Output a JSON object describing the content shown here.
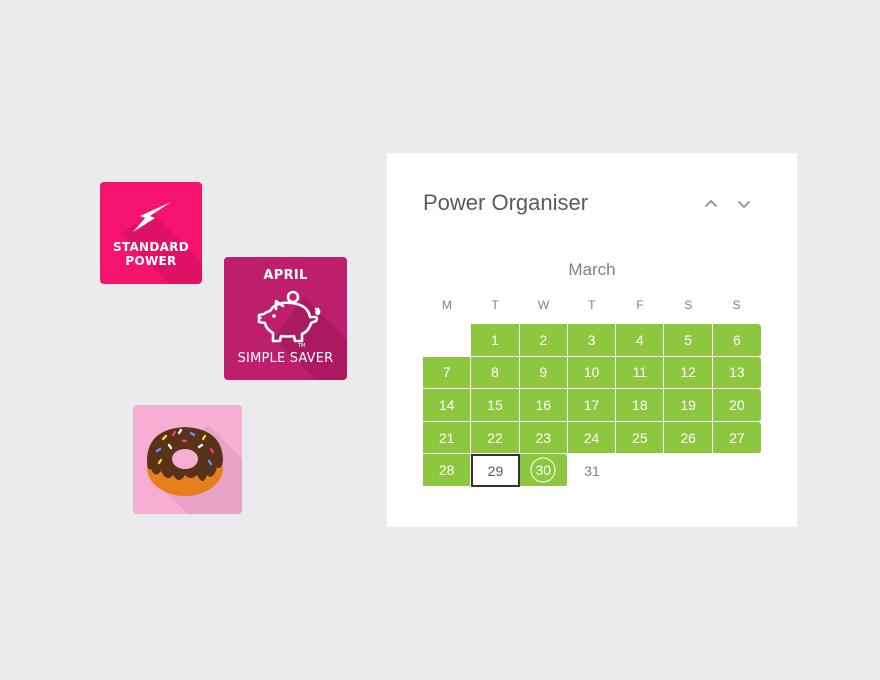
{
  "tiles": {
    "standard_power": {
      "line1": "STANDARD",
      "line2": "POWER",
      "icon": "lightning-bolt-icon",
      "color": "#f4146e"
    },
    "simple_saver": {
      "month": "APRIL",
      "label": "SIMPLE SAVER",
      "icon": "piggy-bank-icon",
      "color": "#be1e6e"
    },
    "donut": {
      "icon": "donut-icon",
      "color": "#f6aed2"
    }
  },
  "calendar": {
    "title": "Power Organiser",
    "month": "March",
    "prev_icon": "chevron-up-icon",
    "next_icon": "chevron-down-icon",
    "accent_color": "#8dc63f",
    "weekdays": [
      "M",
      "T",
      "W",
      "T",
      "F",
      "S",
      "S"
    ],
    "leading_blank_days": 1,
    "days": [
      {
        "label": "1",
        "state": "available"
      },
      {
        "label": "2",
        "state": "available"
      },
      {
        "label": "3",
        "state": "available"
      },
      {
        "label": "4",
        "state": "available"
      },
      {
        "label": "5",
        "state": "available"
      },
      {
        "label": "6",
        "state": "available"
      },
      {
        "label": "7",
        "state": "available"
      },
      {
        "label": "8",
        "state": "available"
      },
      {
        "label": "9",
        "state": "available"
      },
      {
        "label": "10",
        "state": "available"
      },
      {
        "label": "11",
        "state": "available"
      },
      {
        "label": "12",
        "state": "available"
      },
      {
        "label": "13",
        "state": "available"
      },
      {
        "label": "14",
        "state": "available"
      },
      {
        "label": "15",
        "state": "available"
      },
      {
        "label": "16",
        "state": "available"
      },
      {
        "label": "17",
        "state": "available"
      },
      {
        "label": "18",
        "state": "available"
      },
      {
        "label": "19",
        "state": "available"
      },
      {
        "label": "20",
        "state": "available"
      },
      {
        "label": "21",
        "state": "available"
      },
      {
        "label": "22",
        "state": "available"
      },
      {
        "label": "23",
        "state": "available"
      },
      {
        "label": "24",
        "state": "available"
      },
      {
        "label": "25",
        "state": "available"
      },
      {
        "label": "26",
        "state": "available"
      },
      {
        "label": "27",
        "state": "available"
      },
      {
        "label": "28",
        "state": "available"
      },
      {
        "label": "29",
        "state": "today"
      },
      {
        "label": "30",
        "state": "selected"
      },
      {
        "label": "31",
        "state": "plain"
      }
    ]
  }
}
